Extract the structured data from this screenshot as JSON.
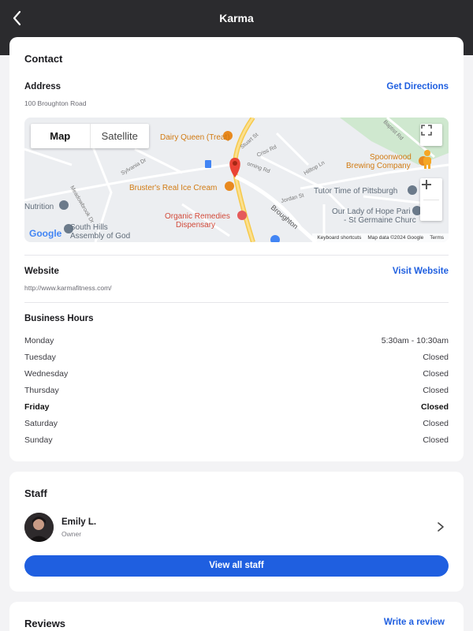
{
  "header": {
    "title": "Karma"
  },
  "contact": {
    "section_title": "Contact",
    "address": {
      "label": "Address",
      "value": "100 Broughton Road",
      "directions_label": "Get Directions"
    },
    "map": {
      "toggle": {
        "map_label": "Map",
        "satellite_label": "Satellite"
      },
      "labels": {
        "dairy_queen": "Dairy Queen (Treat)",
        "brusters": "Bruster's Real Ice Cream",
        "organic": "Organic Remedies",
        "organic2": "Dispensary",
        "spoonwood": "Spoonwood",
        "spoonwood2": "Brewing Company",
        "tutor": "Tutor Time of Pittsburgh",
        "our_lady": "Our Lady of Hope Pari",
        "st_germaine": "- St Germaine Churc",
        "nutrition": "Nutrition",
        "south_hills": "South Hills",
        "south_hills2": "Assembly of God",
        "broughton": "Broughton",
        "stuart": "Stuart St",
        "criss": "Criss Rd",
        "hilltop": "Hilltop Ln",
        "jordan": "Jordan St",
        "baptist": "Baptist Rd",
        "sylvania": "Sylvania Dr",
        "meadowbrook": "Meadowbrook Dr",
        "morning": "orning Rd",
        "google": "Google"
      },
      "footer": {
        "shortcuts": "Keyboard shortcuts",
        "data": "Map data ©2024 Google",
        "terms": "Terms"
      }
    },
    "website": {
      "label": "Website",
      "value": "http://www.karmafitness.com/",
      "visit_label": "Visit Website"
    },
    "hours": {
      "label": "Business Hours",
      "rows": [
        {
          "day": "Monday",
          "time": "5:30am - 10:30am"
        },
        {
          "day": "Tuesday",
          "time": "Closed"
        },
        {
          "day": "Wednesday",
          "time": "Closed"
        },
        {
          "day": "Thursday",
          "time": "Closed"
        },
        {
          "day": "Friday",
          "time": "Closed"
        },
        {
          "day": "Saturday",
          "time": "Closed"
        },
        {
          "day": "Sunday",
          "time": "Closed"
        }
      ]
    }
  },
  "staff": {
    "section_title": "Staff",
    "member": {
      "name": "Emily L.",
      "role": "Owner"
    },
    "view_all_label": "View all staff"
  },
  "reviews": {
    "section_title": "Reviews",
    "write_label": "Write a review"
  },
  "colors": {
    "accent": "#1f5fe0",
    "topbar": "#2b2b2e",
    "map_pin": "#ea4335"
  }
}
